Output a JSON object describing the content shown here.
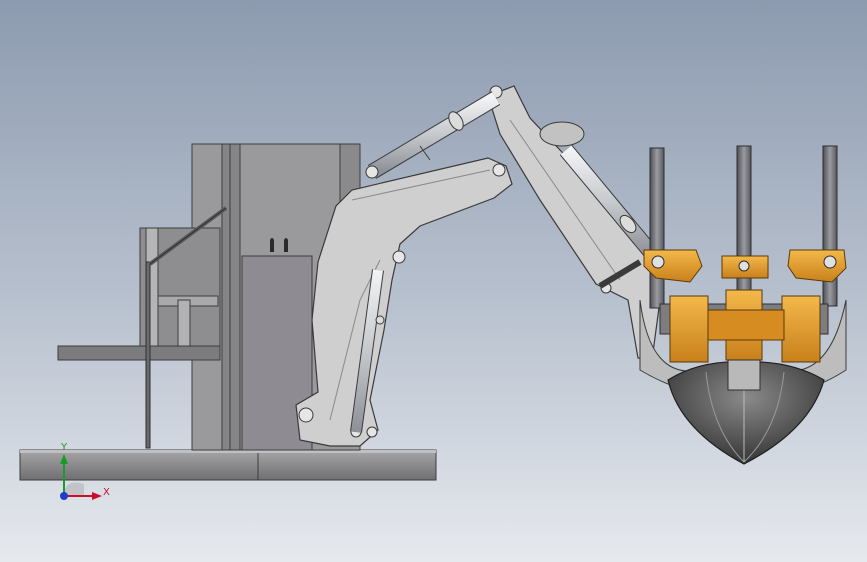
{
  "colors": {
    "background_top": "#8d9bb0",
    "background_bottom": "#e6e9ee",
    "frame_gray": "#9c9c9e",
    "arm_gray": "#c9c9c9",
    "cylinder_steel": "#d4d6d9",
    "bracket_orange": "#e7a12d",
    "blade_dark": "#4a4a4a"
  },
  "triad": {
    "x_label": "X",
    "y_label": "Y",
    "x_color": "#c8102e",
    "y_color": "#1a9a2a",
    "origin_color": "#1a3fd0"
  }
}
